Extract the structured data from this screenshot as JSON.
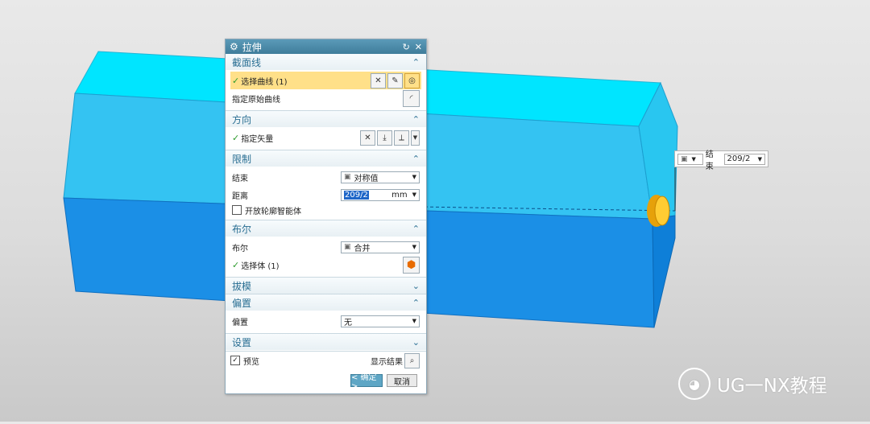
{
  "dialog": {
    "title": "拉伸",
    "reset_icon": "↻",
    "close_icon": "✕",
    "sections": {
      "section_curve": {
        "label": "截面线",
        "select_curve": "选择曲线 (1)",
        "specify_origin": "指定原始曲线"
      },
      "direction": {
        "label": "方向",
        "specify_vector": "指定矢量"
      },
      "limits": {
        "label": "限制",
        "end_label": "结束",
        "end_value": "对称值",
        "distance_label": "距离",
        "distance_value": "209/2",
        "distance_unit": "mm",
        "open_profile": "开放轮廓智能体"
      },
      "boolean": {
        "label": "布尔",
        "bool_label": "布尔",
        "bool_value": "合并",
        "select_body": "选择体 (1)"
      },
      "draft": {
        "label": "拔模"
      },
      "offset": {
        "label": "偏置",
        "offset_label": "偏置",
        "offset_value": "无"
      },
      "settings": {
        "label": "设置"
      }
    },
    "footer": {
      "preview": "预览",
      "show_result": "显示结果",
      "ok": "< 确定 >",
      "cancel": "取消"
    }
  },
  "floating_input": {
    "label": "结束",
    "value": "209/2"
  },
  "watermark": "UG一NX教程",
  "colors": {
    "part_top": "#00e5ff",
    "part_front": "#1b8fe6",
    "part_right": "#0e7fd8",
    "highlight": "#ffe089",
    "accent": "#3f7d9b"
  }
}
